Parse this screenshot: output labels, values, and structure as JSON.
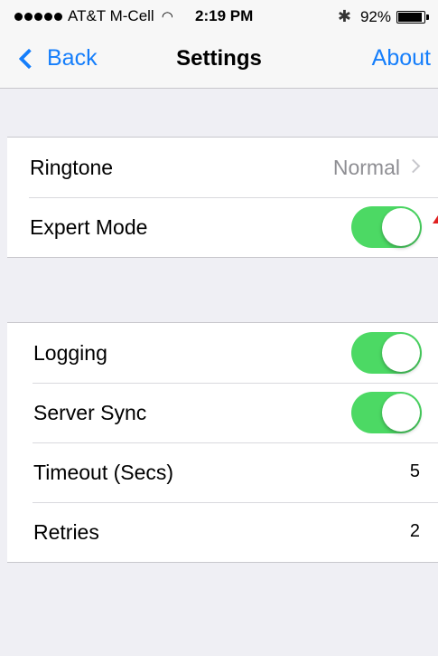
{
  "status_bar": {
    "carrier": "AT&T M-Cell",
    "time": "2:19 PM",
    "battery_percent": "92%",
    "battery_level": 0.92,
    "signal_bars": 5,
    "icons": [
      "wifi-icon",
      "bluetooth-icon",
      "battery-icon"
    ]
  },
  "nav": {
    "back_label": "Back",
    "title": "Settings",
    "right_label": "About"
  },
  "group1": {
    "ringtone": {
      "label": "Ringtone",
      "value": "Normal"
    },
    "expert_mode": {
      "label": "Expert Mode",
      "on": true
    }
  },
  "group2": {
    "logging": {
      "label": "Logging",
      "on": true
    },
    "server_sync": {
      "label": "Server Sync",
      "on": true
    },
    "timeout": {
      "label": "Timeout (Secs)",
      "value": "5"
    },
    "retries": {
      "label": "Retries",
      "value": "2"
    }
  },
  "colors": {
    "accent": "#157efb",
    "toggle_on": "#4cd964",
    "background": "#efeff4"
  }
}
